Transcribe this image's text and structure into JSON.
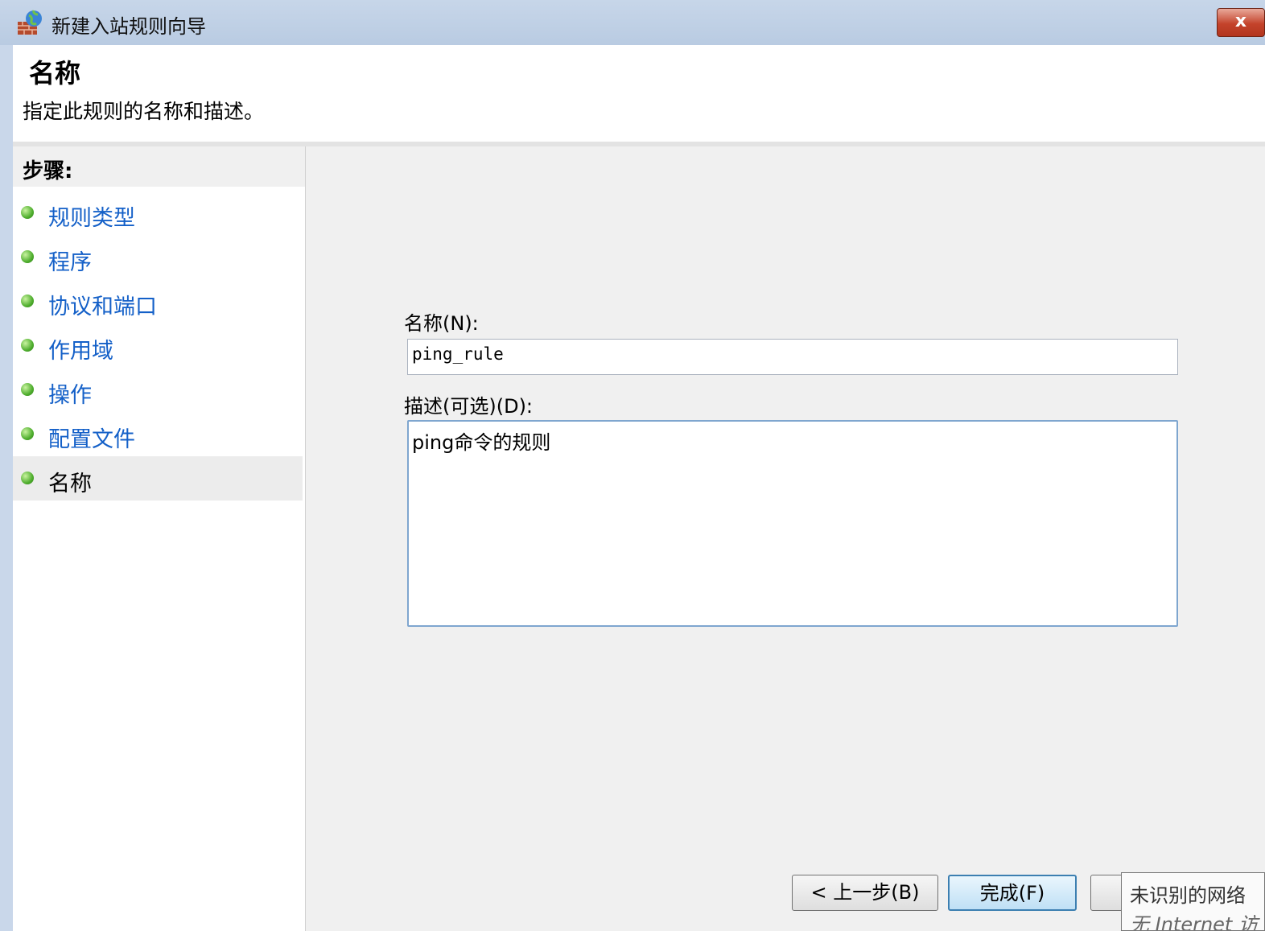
{
  "window": {
    "title": "新建入站规则向导",
    "close_label": "x"
  },
  "header": {
    "title": "名称",
    "subtitle": "指定此规则的名称和描述。"
  },
  "steps": {
    "heading": "步骤:",
    "items": [
      {
        "label": "规则类型",
        "active": false
      },
      {
        "label": "程序",
        "active": false
      },
      {
        "label": "协议和端口",
        "active": false
      },
      {
        "label": "作用域",
        "active": false
      },
      {
        "label": "操作",
        "active": false
      },
      {
        "label": "配置文件",
        "active": false
      },
      {
        "label": "名称",
        "active": true
      }
    ]
  },
  "form": {
    "name_label": "名称(N):",
    "name_value": "ping_rule",
    "desc_label": "描述(可选)(D):",
    "desc_value": "ping命令的规则"
  },
  "buttons": {
    "back": "< 上一步(B)",
    "finish": "完成(F)",
    "cancel": ""
  },
  "tooltip": {
    "line1": "未识别的网络",
    "line2": "无 Internet 访"
  }
}
